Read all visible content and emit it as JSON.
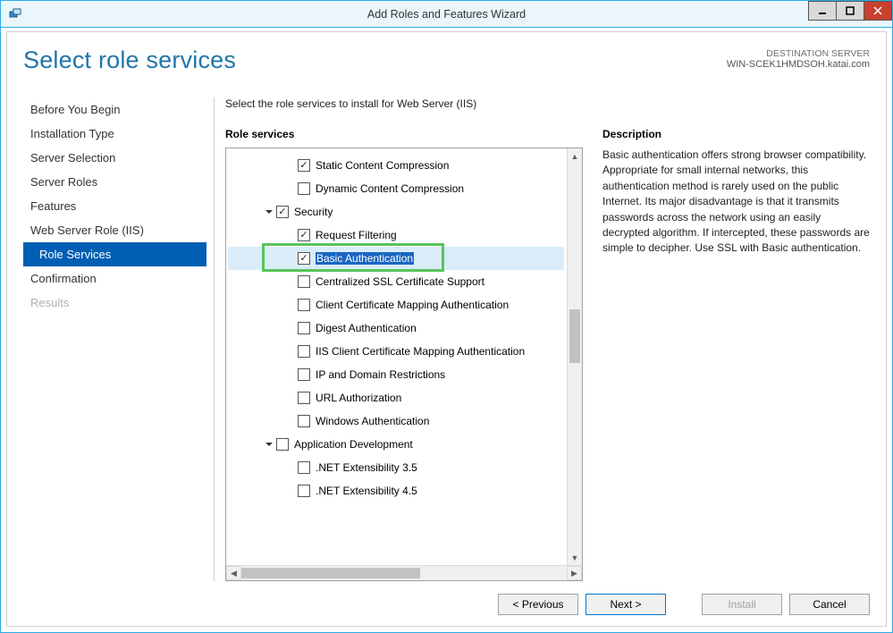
{
  "window": {
    "title": "Add Roles and Features Wizard"
  },
  "header": {
    "page_title": "Select role services",
    "destination_label": "DESTINATION SERVER",
    "destination_value": "WIN-SCEK1HMDSOH.katai.com"
  },
  "nav": {
    "items": [
      {
        "label": "Before You Begin",
        "state": "normal"
      },
      {
        "label": "Installation Type",
        "state": "normal"
      },
      {
        "label": "Server Selection",
        "state": "normal"
      },
      {
        "label": "Server Roles",
        "state": "normal"
      },
      {
        "label": "Features",
        "state": "normal"
      },
      {
        "label": "Web Server Role (IIS)",
        "state": "normal"
      },
      {
        "label": "Role Services",
        "state": "selected"
      },
      {
        "label": "Confirmation",
        "state": "normal"
      },
      {
        "label": "Results",
        "state": "disabled"
      }
    ]
  },
  "main": {
    "instruction": "Select the role services to install for Web Server (IIS)",
    "role_services_label": "Role services",
    "description_label": "Description",
    "description_text": "Basic authentication offers strong browser compatibility. Appropriate for small internal networks, this authentication method is rarely used on the public Internet. Its major disadvantage is that it transmits passwords across the network using an easily decrypted algorithm. If intercepted, these passwords are simple to decipher. Use SSL with Basic authentication."
  },
  "tree": {
    "items": [
      {
        "indent": 3,
        "expander": "none",
        "checked": true,
        "label": "Static Content Compression",
        "selected": false
      },
      {
        "indent": 3,
        "expander": "none",
        "checked": false,
        "label": "Dynamic Content Compression",
        "selected": false
      },
      {
        "indent": 2,
        "expander": "open",
        "checked": true,
        "label": "Security",
        "selected": false
      },
      {
        "indent": 3,
        "expander": "none",
        "checked": true,
        "label": "Request Filtering",
        "selected": false
      },
      {
        "indent": 3,
        "expander": "none",
        "checked": true,
        "label": "Basic Authentication",
        "selected": true
      },
      {
        "indent": 3,
        "expander": "none",
        "checked": false,
        "label": "Centralized SSL Certificate Support",
        "selected": false
      },
      {
        "indent": 3,
        "expander": "none",
        "checked": false,
        "label": "Client Certificate Mapping Authentication",
        "selected": false
      },
      {
        "indent": 3,
        "expander": "none",
        "checked": false,
        "label": "Digest Authentication",
        "selected": false
      },
      {
        "indent": 3,
        "expander": "none",
        "checked": false,
        "label": "IIS Client Certificate Mapping Authentication",
        "selected": false
      },
      {
        "indent": 3,
        "expander": "none",
        "checked": false,
        "label": "IP and Domain Restrictions",
        "selected": false
      },
      {
        "indent": 3,
        "expander": "none",
        "checked": false,
        "label": "URL Authorization",
        "selected": false
      },
      {
        "indent": 3,
        "expander": "none",
        "checked": false,
        "label": "Windows Authentication",
        "selected": false
      },
      {
        "indent": 2,
        "expander": "open",
        "checked": false,
        "label": "Application Development",
        "selected": false
      },
      {
        "indent": 3,
        "expander": "none",
        "checked": false,
        "label": ".NET Extensibility 3.5",
        "selected": false
      },
      {
        "indent": 3,
        "expander": "none",
        "checked": false,
        "label": ".NET Extensibility 4.5",
        "selected": false
      }
    ]
  },
  "buttons": {
    "previous": "< Previous",
    "next": "Next >",
    "install": "Install",
    "cancel": "Cancel"
  }
}
